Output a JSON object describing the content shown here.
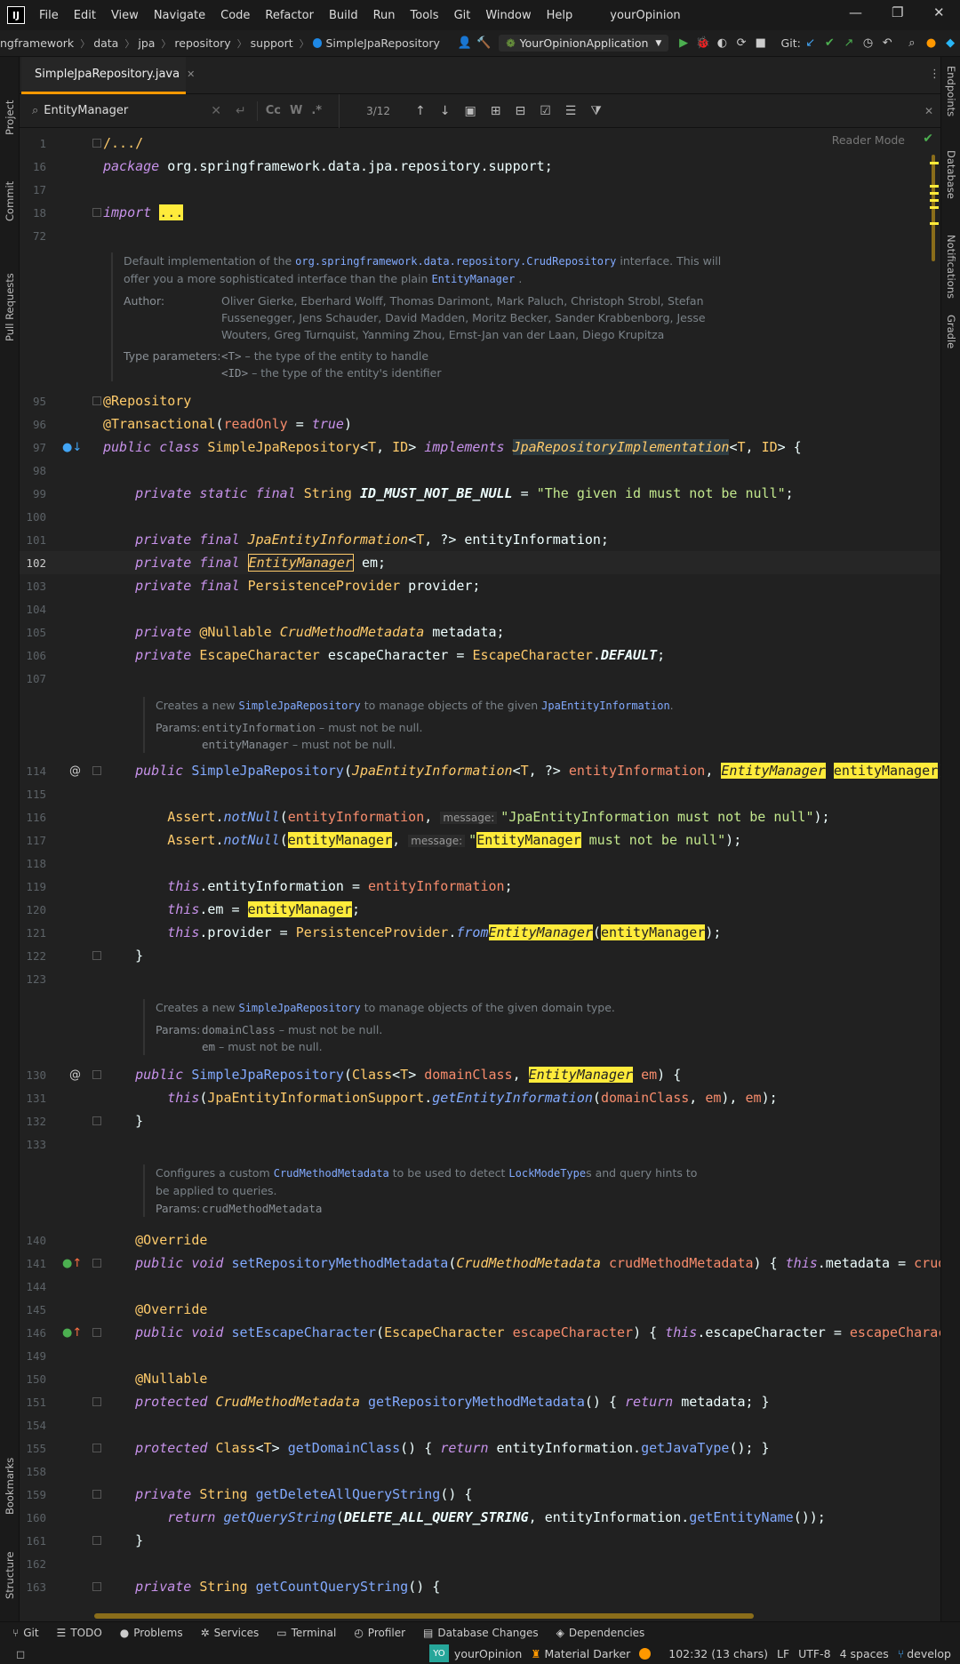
{
  "menubar": {
    "logo": "IJ",
    "items": [
      "File",
      "Edit",
      "View",
      "Navigate",
      "Code",
      "Refactor",
      "Build",
      "Run",
      "Tools",
      "Git",
      "Window",
      "Help"
    ],
    "project_title": "yourOpinion"
  },
  "navbar": {
    "breadcrumbs": [
      "ngframework",
      "data",
      "jpa",
      "repository",
      "support",
      "SimpleJpaRepository"
    ],
    "run_config": "YourOpinionApplication",
    "git_label": "Git:"
  },
  "tab": {
    "file_name": "SimpleJpaRepository.java"
  },
  "find": {
    "query": "EntityManager",
    "match_case": "Cc",
    "whole_words": "W",
    "regex": ".*",
    "match_count": "3/12"
  },
  "side_tabs": {
    "left": [
      "Project",
      "Commit",
      "Pull Requests",
      "Bookmarks",
      "Structure"
    ],
    "right": [
      "Endpoints",
      "Database",
      "Notifications",
      "Gradle"
    ]
  },
  "editor": {
    "reader_mode": "Reader Mode"
  },
  "docs": {
    "class_doc": {
      "line1_pre": "Default implementation of the ",
      "line1_link": "org.springframework.data.repository.CrudRepository",
      "line1_post": " interface. This will",
      "line2_pre": "offer you a more sophisticated interface than the plain ",
      "line2_link": "EntityManager",
      "line2_post": " .",
      "author_label": "Author:",
      "author_lines": [
        "Oliver Gierke, Eberhard Wolff, Thomas Darimont, Mark Paluch, Christoph Strobl, Stefan",
        "Fussenegger, Jens Schauder, David Madden, Moritz Becker, Sander Krabbenborg, Jesse",
        "Wouters, Greg Turnquist, Yanming Zhou, Ernst-Jan van der Laan, Diego Krupitza"
      ],
      "type_label": "Type parameters:",
      "type_params": [
        {
          "code": "<T>",
          "text": " – the type of the entity to handle"
        },
        {
          "code": "<ID>",
          "text": " – the type of the entity's identifier"
        }
      ]
    },
    "ctor1_doc": {
      "pre": "Creates a new ",
      "link1": "SimpleJpaRepository",
      "mid": " to manage objects of the given ",
      "link2": "JpaEntityInformation",
      "post": ".",
      "params_label": "Params:",
      "params": [
        {
          "code": "entityInformation",
          "text": " – must not be null."
        },
        {
          "code": "entityManager",
          "text": " – must not be null."
        }
      ]
    },
    "ctor2_doc": {
      "pre": "Creates a new ",
      "link1": "SimpleJpaRepository",
      "post": " to manage objects of the given domain type.",
      "params_label": "Params:",
      "params": [
        {
          "code": "domainClass",
          "text": " – must not be null."
        },
        {
          "code": "em",
          "text": " – must not be null."
        }
      ]
    },
    "meta_doc": {
      "pre": "Configures a custom ",
      "link1": "CrudMethodMetadata",
      "mid": " to be used to detect ",
      "link2": "LockModeType",
      "post": "s and query hints to",
      "line2": "be applied to queries.",
      "params_label": "Params:",
      "param": "crudMethodMetadata"
    }
  },
  "lines": {
    "l1": "1",
    "l16": "16",
    "l17": "17",
    "l18": "18",
    "l72": "72",
    "l95": "95",
    "l96": "96",
    "l97": "97",
    "l98": "98",
    "l99": "99",
    "l100": "100",
    "l101": "101",
    "l102": "102",
    "l103": "103",
    "l104": "104",
    "l105": "105",
    "l106": "106",
    "l107": "107",
    "l114": "114",
    "l115": "115",
    "l116": "116",
    "l117": "117",
    "l118": "118",
    "l119": "119",
    "l120": "120",
    "l121": "121",
    "l122": "122",
    "l123": "123",
    "l130": "130",
    "l131": "131",
    "l132": "132",
    "l133": "133",
    "l140": "140",
    "l141": "141",
    "l144": "144",
    "l145": "145",
    "l146": "146",
    "l149": "149",
    "l150": "150",
    "l151": "151",
    "l154": "154",
    "l155": "155",
    "l158": "158",
    "l159": "159",
    "l160": "160",
    "l161": "161",
    "l162": "162",
    "l163": "163"
  },
  "bottom_tools": [
    "Git",
    "TODO",
    "Problems",
    "Services",
    "Terminal",
    "Profiler",
    "Database Changes",
    "Dependencies"
  ],
  "status": {
    "vcs_badge": "YO",
    "project": "yourOpinion",
    "theme": "Material Darker",
    "caret": "102:32 (13 chars)",
    "line_sep": "LF",
    "encoding": "UTF-8",
    "indent": "4 spaces",
    "branch": "develop"
  },
  "colors": {
    "accent": "#ff9800",
    "match_highlight": "#ffeb3b",
    "background": "#212121"
  }
}
